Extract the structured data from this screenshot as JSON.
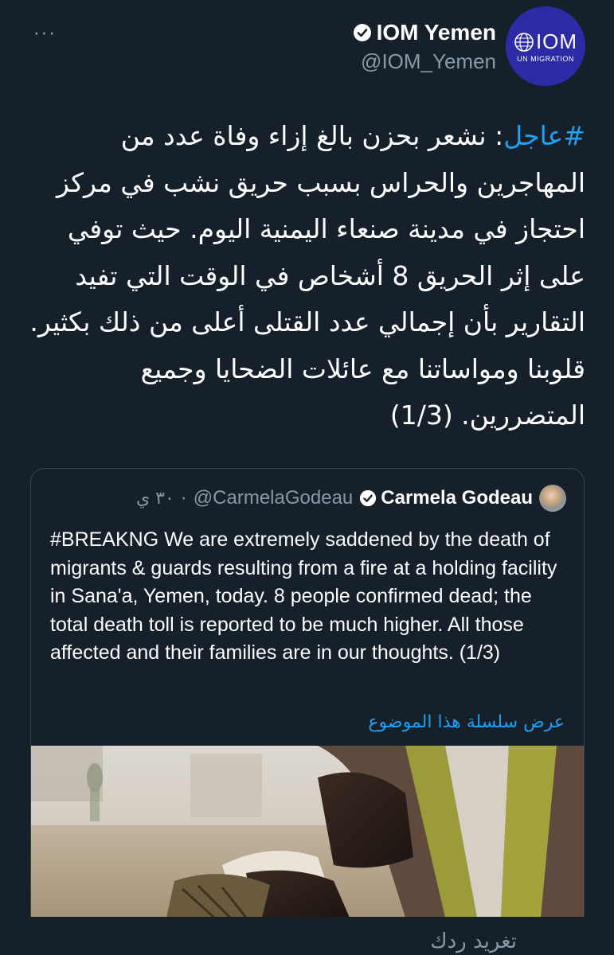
{
  "header": {
    "more_label": "···",
    "author_name": "IOM Yemen",
    "author_handle": "@IOM_Yemen",
    "avatar": {
      "logo_text": "IOM",
      "logo_subtext": "UN MIGRATION",
      "bg_color": "#2d2aa5"
    }
  },
  "tweet": {
    "hashtag": "#عاجل",
    "text": ": نشعر بحزن بالغ إزاء وفاة عدد من المهاجرين والحراس بسبب حريق نشب في مركز احتجاز في مدينة صنعاء اليمنية اليوم. حيث توفي على إثر الحريق 8 أشخاص في الوقت التي تفيد التقارير بأن إجمالي عدد القتلى أعلى من ذلك بكثير. قلوبنا ومواساتنا مع عائلات الضحايا وجميع المتضررين. (1/3)"
  },
  "quoted_tweet": {
    "name": "Carmela Godeau",
    "handle": "@CarmelaGodeau",
    "time": "٣٠ ي",
    "separator": "·",
    "text": "#BREAKNG We are extremely saddened by the death of migrants & guards resulting from a fire at a holding facility in Sana'a, Yemen, today. 8 people confirmed dead; the total death toll is reported to be much higher. All those affected and their families are in our thoughts. (1/3)",
    "thread_link": "عرض سلسلة هذا الموضوع"
  },
  "footer": {
    "reply_hint": "تغريد ردك"
  },
  "colors": {
    "background": "#15202b",
    "accent": "#1da1f2",
    "secondary_text": "#8899a6",
    "border": "#38444d"
  },
  "icons": [
    "more-icon",
    "verified-icon",
    "iom-logo-icon"
  ]
}
